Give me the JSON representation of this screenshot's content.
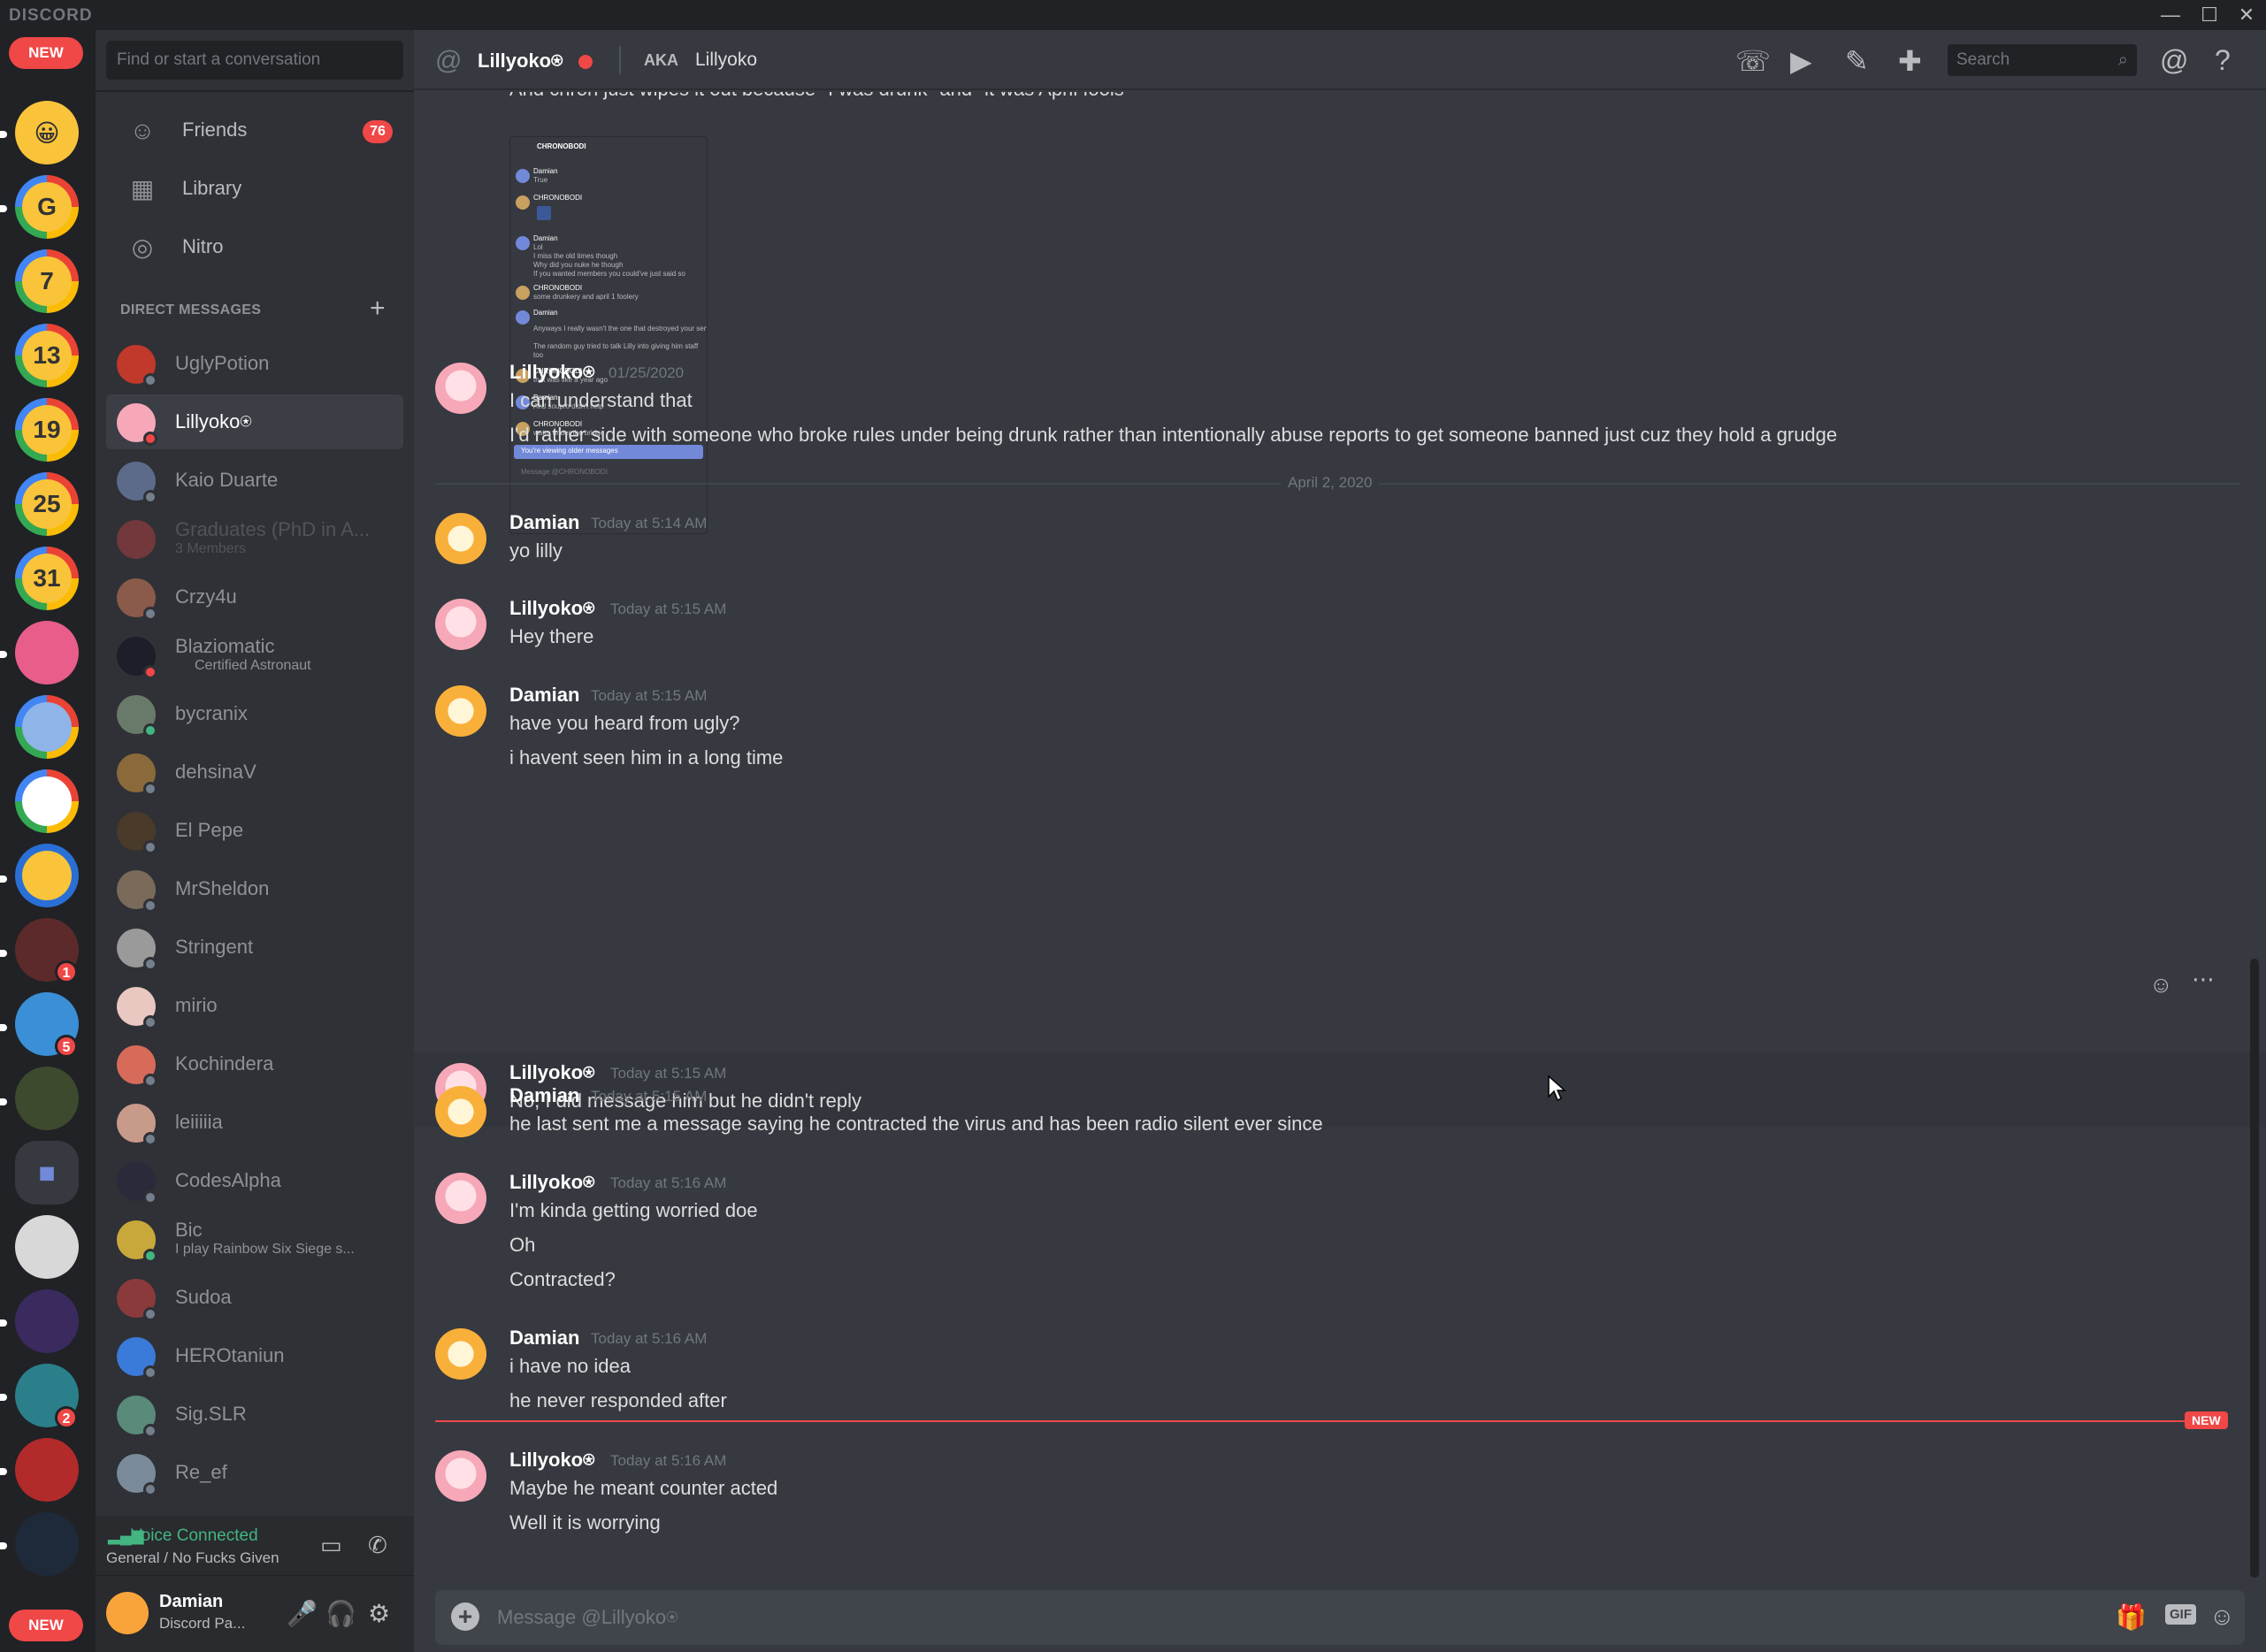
{
  "titlebar": {
    "brand": "DISCORD",
    "minimize": "—",
    "maximize": "☐",
    "close": "✕"
  },
  "servers": {
    "new_top": "NEW",
    "new_bottom": "NEW",
    "items": [
      {
        "label": "😀",
        "color": "#f9c43a"
      },
      {
        "label": "G",
        "color": "#e3c63c"
      },
      {
        "label": "7",
        "color": "#e3c63c"
      },
      {
        "label": "13",
        "color": "#e3c63c"
      },
      {
        "label": "19",
        "color": "#e3c63c"
      },
      {
        "label": "25",
        "color": "#e3c63c"
      },
      {
        "label": "31",
        "color": "#e3c63c"
      }
    ],
    "badges": [
      "1",
      "5",
      "2"
    ]
  },
  "sidebar": {
    "search_placeholder": "Find or start a conversation",
    "nav": [
      {
        "label": "Friends",
        "badge": "76"
      },
      {
        "label": "Library"
      },
      {
        "label": "Nitro"
      }
    ],
    "dm_header": "DIRECT MESSAGES",
    "dms": [
      {
        "name": "UglyPotion"
      },
      {
        "name": "Lillyoko⍟"
      },
      {
        "name": "Kaio Duarte"
      },
      {
        "name": "Graduates (PhD in A...",
        "sub": "3 Members"
      },
      {
        "name": "Crzy4u"
      },
      {
        "name": "Blaziomatic",
        "sub": "Certified Astronaut"
      },
      {
        "name": "bycranix"
      },
      {
        "name": "dehsinaV"
      },
      {
        "name": "El Pepe"
      },
      {
        "name": "MrSheldon"
      },
      {
        "name": "Stringent"
      },
      {
        "name": "mirio"
      },
      {
        "name": "Kochindera"
      },
      {
        "name": "leiiiiia"
      },
      {
        "name": "CodesAlpha"
      },
      {
        "name": "Bic",
        "sub": "I play Rainbow Six Siege s..."
      },
      {
        "name": "Sudoa"
      },
      {
        "name": "HEROtaniun"
      },
      {
        "name": "Sig.SLR"
      },
      {
        "name": "Re_ef"
      }
    ],
    "voice": {
      "title": "Voice Connected",
      "channel": "General / No Fucks Given"
    },
    "user": {
      "name": "Damian",
      "status": "Discord Pa..."
    }
  },
  "chat": {
    "title": "Lillyoko⍟",
    "aka_label": "AKA",
    "aka_name": "Lillyoko",
    "search_placeholder": "Search",
    "prev_line": "And chron just wipes it out because \"I was drunk\" and \"it was April fools\"",
    "embed": {
      "header": "CHRONOBODI",
      "rows": [
        "Damian",
        "True",
        "CHRONOBODI",
        "Damian",
        "Lol",
        "I miss the old times though",
        "Why did you nuke he though",
        "If you wanted members you could've just said so",
        "CHRONOBODI",
        "some drunkery and april 1 foolery",
        "Damian",
        "Anyways I really wasn't the one that destroyed your server",
        "The random guy tried to talk Lilly into giving him staff",
        "too",
        "CHRONOBODI",
        "that was like a year ago",
        "Damian",
        "And soupro didn't help",
        "CHRONOBODI",
        "water under the bridge"
      ],
      "banner": "You're viewing older messages",
      "input": "Message @CHRONOBODI"
    },
    "date_divider": "April 2, 2020",
    "new_label": "NEW",
    "composer_placeholder": "Message @Lillyoko⍟",
    "messages": [
      {
        "author": "Lillyoko⍟",
        "ts": "01/25/2020",
        "lines": [
          "I can understand that",
          "I'd rather side with someone who broke rules under being drunk rather than intentionally abuse reports to get someone banned just cuz they hold a grudge"
        ]
      },
      {
        "author": "Damian",
        "ts": "Today at 5:14 AM",
        "lines": [
          "yo lilly"
        ]
      },
      {
        "author": "Lillyoko⍟",
        "ts": "Today at 5:15 AM",
        "lines": [
          "Hey there"
        ]
      },
      {
        "author": "Damian",
        "ts": "Today at 5:15 AM",
        "lines": [
          "have you heard from ugly?",
          "i havent seen him in a long time"
        ]
      },
      {
        "author": "Lillyoko⍟",
        "ts": "Today at 5:15 AM",
        "lines": [
          "No, I did message him but he didn't reply"
        ]
      },
      {
        "author": "Damian",
        "ts": "Today at 5:15 AM",
        "lines": [
          "he last sent me a message saying he contracted the virus and has been radio silent ever since"
        ]
      },
      {
        "author": "Lillyoko⍟",
        "ts": "Today at 5:16 AM",
        "lines": [
          "I'm kinda getting worried doe",
          "Oh",
          "Contracted?"
        ]
      },
      {
        "author": "Damian",
        "ts": "Today at 5:16 AM",
        "lines": [
          "i have no idea",
          "he never responded after"
        ]
      },
      {
        "author": "Lillyoko⍟",
        "ts": "Today at 5:16 AM",
        "lines": [
          "Maybe he meant counter acted",
          "Well it is worrying"
        ]
      }
    ]
  }
}
